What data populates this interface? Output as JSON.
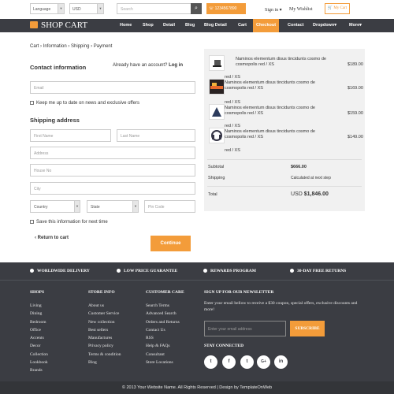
{
  "topbar": {
    "language": "Language",
    "currency": "USD",
    "search_placeholder": "Search",
    "phone": "1234567890",
    "signin": "Sign in",
    "wishlist": "My Wishlist",
    "cart": "My Cart"
  },
  "nav": {
    "logo": "SHOP CART",
    "items": [
      "Home",
      "Shop",
      "Detail",
      "Blog",
      "Blog Detail",
      "Cart",
      "Checkout",
      "Contact",
      "Dropdown",
      "More"
    ],
    "active": "Checkout"
  },
  "breadcrumb": [
    "Cart",
    "Information",
    "Shipping",
    "Payment"
  ],
  "contact": {
    "title": "Contact information",
    "have_account": "Already have an account?",
    "login": "Log in",
    "email_placeholder": "Email",
    "newsletter_check": "Keep me up to date on news and exclusive offers"
  },
  "shipping": {
    "title": "Shipping address",
    "first_name": "First Name",
    "last_name": "Last Name",
    "address": "Address",
    "house_no": "House No",
    "city": "City",
    "country": "Country",
    "state": "State",
    "pin": "Pin Code",
    "save_check": "Save this information for next time",
    "return": "Return to cart",
    "continue": "Continue"
  },
  "order": {
    "items": [
      {
        "name": "Naminos elementum disus tincidunts cosmo de cosmopolis red / XS",
        "price": "$189.00",
        "variant": "red / XS"
      },
      {
        "name": "Naminos elementum disus tincidunts cosmo de cosmopolis red / XS",
        "price": "$169.00",
        "variant": "red / XS"
      },
      {
        "name": "Naminos elementum disus tincidunts cosmo de cosmopolis red / XS",
        "price": "$159.00",
        "variant": "red / XS"
      },
      {
        "name": "Naminos elementum disus tincidunts cosmo de cosmopolis red / XS",
        "price": "$149.00",
        "variant": "red / XS"
      }
    ],
    "subtotal_label": "Subtotal",
    "subtotal": "$666.00",
    "shipping_label": "Shipping",
    "shipping": "Calculated at next step",
    "total_label": "Total",
    "currency": "USD",
    "total": "$1,846.00"
  },
  "footer": {
    "features": [
      "WORLDWIDE DELIVERY",
      "LOW PRICE GUARANTEE",
      "REWARDS PROGRAM",
      "30-DAY FREE RETURNS"
    ],
    "shops_title": "SHOPS",
    "shops": [
      "Living",
      "Dining",
      "Bedroom",
      "Office",
      "Accents",
      "Decor",
      "Collection",
      "Lookbook",
      "Brands"
    ],
    "store_title": "STORE INFO",
    "store": [
      "About us",
      "Customer Service",
      "New collection",
      "Best sellers",
      "Manufactures",
      "Privacy policy",
      "Terms & condition",
      "Blog"
    ],
    "care_title": "CUSTOMER CARE",
    "care": [
      "Search Terms",
      "Advanced Search",
      "Orders and Returns",
      "Contact Us",
      "RSS",
      "Help & FAQs",
      "Consultant",
      "Store Locations"
    ],
    "newsletter_title": "SIGN UP FOR OUR NEWSLETTER",
    "newsletter_text": "Enter your email bellow to receive a $30 coupon, special offers, exclusive discounts and more!",
    "email_placeholder": "Enter your email address",
    "subscribe": "SUBSCRIBE",
    "stay": "STAY CONNECTED",
    "social": [
      "t",
      "f",
      "t",
      "G+",
      "in"
    ],
    "copyright": "© 2013 Your Website Name. All Rights Reserved | Design by TemplateOnWeb"
  },
  "colors": {
    "accent": "#f39c3a",
    "dark": "#3b3d43"
  }
}
